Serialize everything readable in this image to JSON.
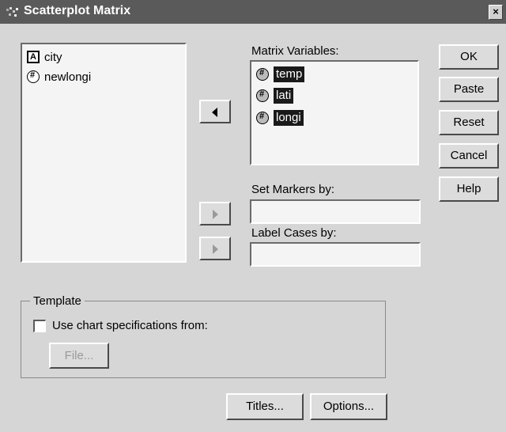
{
  "window": {
    "title": "Scatterplot Matrix",
    "close_label": "×"
  },
  "source_list": {
    "items": [
      {
        "label": "city",
        "type_icon": "string-variable-icon"
      },
      {
        "label": "newlongi",
        "type_icon": "numeric-variable-icon"
      }
    ]
  },
  "matrix_variables": {
    "label": "Matrix Variables:",
    "items": [
      "temp",
      "lati",
      "longi"
    ]
  },
  "set_markers": {
    "label": "Set Markers by:",
    "value": ""
  },
  "label_cases": {
    "label": "Label Cases by:",
    "value": ""
  },
  "buttons": {
    "ok": "OK",
    "paste": "Paste",
    "reset": "Reset",
    "cancel": "Cancel",
    "help": "Help",
    "titles": "Titles...",
    "options": "Options..."
  },
  "template": {
    "group_label": "Template",
    "checkbox_label": "Use chart specifications from:",
    "checked": false,
    "file_button": "File..."
  }
}
